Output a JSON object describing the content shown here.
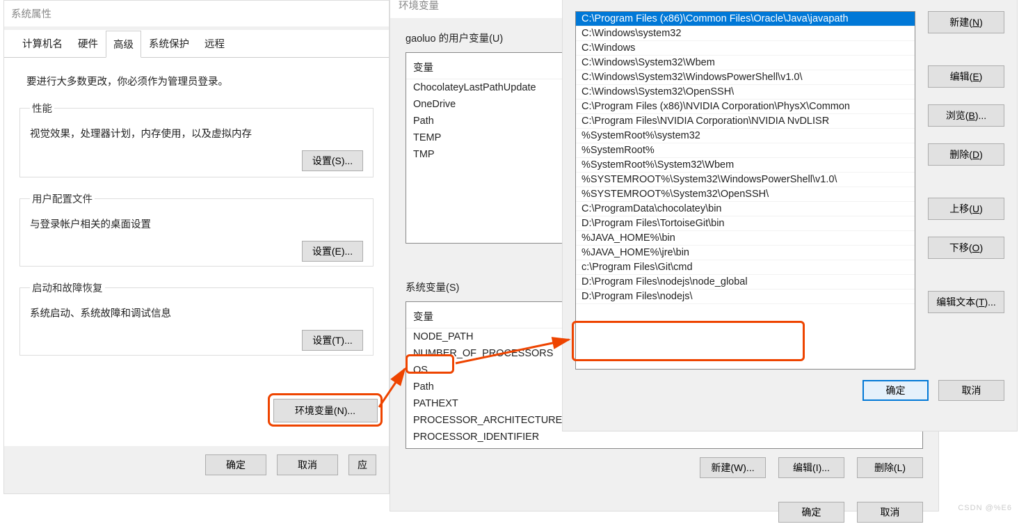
{
  "d1": {
    "title": "系统属性",
    "tabs": [
      "计算机名",
      "硬件",
      "高级",
      "系统保护",
      "远程"
    ],
    "active_tab": 2,
    "admin_note": "要进行大多数更改，你必须作为管理员登录。",
    "perf": {
      "legend": "性能",
      "desc": "视觉效果，处理器计划，内存使用，以及虚拟内存",
      "btn": "设置(S)..."
    },
    "profile": {
      "legend": "用户配置文件",
      "desc": "与登录帐户相关的桌面设置",
      "btn": "设置(E)..."
    },
    "startup": {
      "legend": "启动和故障恢复",
      "desc": "系统启动、系统故障和调试信息",
      "btn": "设置(T)..."
    },
    "env_btn": "环境变量(N)...",
    "ok": "确定",
    "cancel": "取消",
    "apply": "应"
  },
  "d2": {
    "title": "环境变量",
    "user_label": "gaoluo 的用户变量(U)",
    "col_header": "变量",
    "user_vars": [
      "ChocolateyLastPathUpdate",
      "OneDrive",
      "Path",
      "TEMP",
      "TMP"
    ],
    "sys_label": "系统变量(S)",
    "sys_vars": [
      "NODE_PATH",
      "NUMBER_OF_PROCESSORS",
      "OS",
      "Path",
      "PATHEXT",
      "PROCESSOR_ARCHITECTURE",
      "PROCESSOR_IDENTIFIER"
    ],
    "new": "新建(W)...",
    "edit": "编辑(I)...",
    "del": "删除(L)",
    "ok": "确定",
    "cancel": "取消"
  },
  "d3": {
    "paths": [
      "C:\\Program Files (x86)\\Common Files\\Oracle\\Java\\javapath",
      "C:\\Windows\\system32",
      "C:\\Windows",
      "C:\\Windows\\System32\\Wbem",
      "C:\\Windows\\System32\\WindowsPowerShell\\v1.0\\",
      "C:\\Windows\\System32\\OpenSSH\\",
      "C:\\Program Files (x86)\\NVIDIA Corporation\\PhysX\\Common",
      "C:\\Program Files\\NVIDIA Corporation\\NVIDIA NvDLISR",
      "%SystemRoot%\\system32",
      "%SystemRoot%",
      "%SystemRoot%\\System32\\Wbem",
      "%SYSTEMROOT%\\System32\\WindowsPowerShell\\v1.0\\",
      "%SYSTEMROOT%\\System32\\OpenSSH\\",
      "C:\\ProgramData\\chocolatey\\bin",
      "D:\\Program Files\\TortoiseGit\\bin",
      "%JAVA_HOME%\\bin",
      "%JAVA_HOME%\\jre\\bin",
      "c:\\Program Files\\Git\\cmd",
      "D:\\Program Files\\nodejs\\node_global",
      "D:\\Program Files\\nodejs\\"
    ],
    "selected_index": 0,
    "btns": {
      "new": "新建(N)",
      "edit": "编辑(E)",
      "browse": "浏览(B)...",
      "del": "删除(D)",
      "up": "上移(U)",
      "down": "下移(O)",
      "edit_text": "编辑文本(T)..."
    },
    "ok": "确定",
    "cancel": "取消"
  },
  "watermark": "CSDN @%E6"
}
